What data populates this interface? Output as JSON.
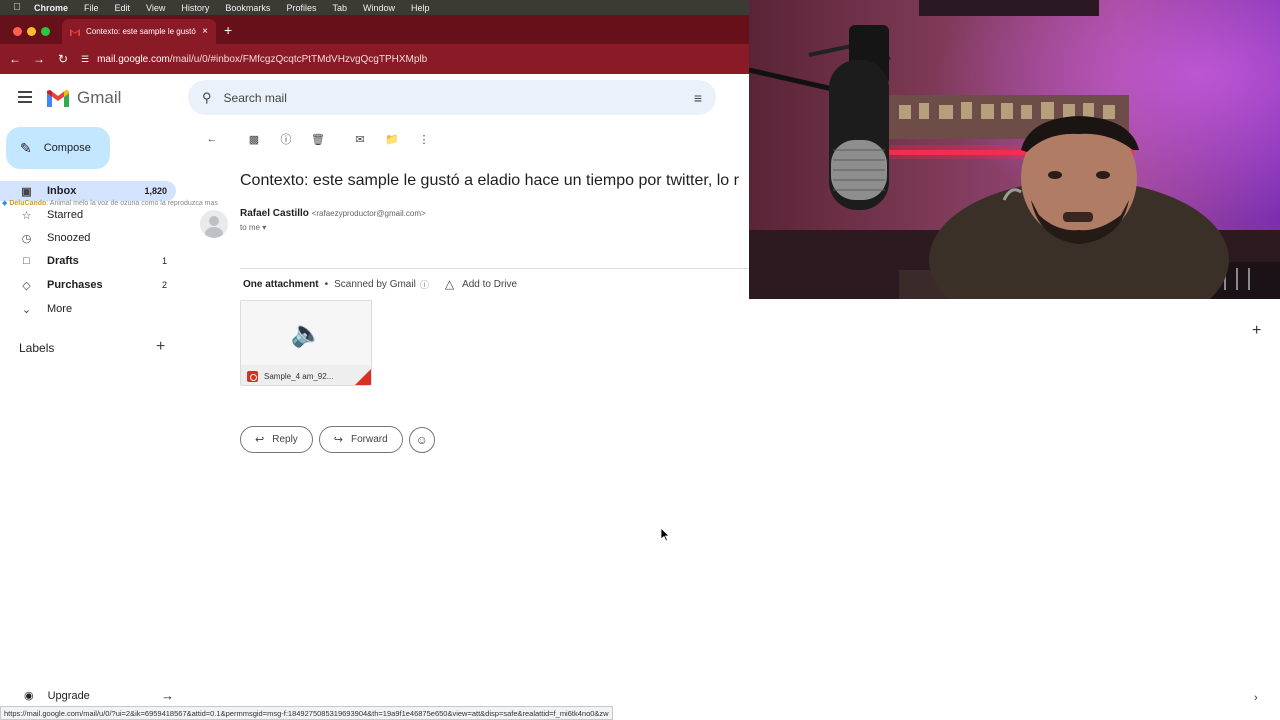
{
  "menubar": {
    "items": [
      "Chrome",
      "File",
      "Edit",
      "View",
      "History",
      "Bookmarks",
      "Profiles",
      "Tab",
      "Window",
      "Help"
    ]
  },
  "browser": {
    "tab_title": "Contexto: este sample le gustó",
    "url_host": "mail.google.com",
    "url_path": "/mail/u/0/#inbox/FMfcgzQcqtcPtTMdVHzvgQcgTPHXMplb",
    "status_url": "https://mail.google.com/mail/u/0/?ui=2&ik=6959418567&attid=0.1&permmsgid=msg-f:1849275085319693904&th=19a9f1e46875e650&view=att&disp=safe&realattid=f_mi6tk4no0&zw"
  },
  "gmail": {
    "product_name": "Gmail",
    "compose_label": "Compose",
    "search_placeholder": "Search mail",
    "nav": [
      {
        "label": "Inbox",
        "count": "1,820",
        "icon": "inbox-icon"
      },
      {
        "label": "Starred",
        "count": "",
        "icon": "star-icon"
      },
      {
        "label": "Snoozed",
        "count": "",
        "icon": "clock-icon"
      },
      {
        "label": "Drafts",
        "count": "1",
        "icon": "draft-icon"
      },
      {
        "label": "Purchases",
        "count": "2",
        "icon": "tag-icon"
      },
      {
        "label": "More",
        "count": "",
        "icon": "chevron-down-icon"
      }
    ],
    "labels_heading": "Labels",
    "upgrade_label": "Upgrade"
  },
  "email": {
    "subject": "Contexto: este sample le gustó a eladio hace un tiempo por twitter, lo r",
    "sender_name": "Rafael Castillo",
    "sender_email": "<rafaezyproductor@gmail.com>",
    "to_line": "to me",
    "attachment_header": "One attachment",
    "scanned_label": "Scanned by Gmail",
    "add_to_drive": "Add to Drive",
    "attachment_name": "Sample_4 am_92...",
    "reply_label": "Reply",
    "forward_label": "Forward"
  },
  "overlay_chat": {
    "name": "DeluCando",
    "message": ": Animal melo la voz de ozuna como la reproduzca mas"
  },
  "colors": {
    "chrome_frame": "#8a1a25",
    "gmail_active": "#d3e3fd",
    "compose_bg": "#c2e7ff"
  }
}
